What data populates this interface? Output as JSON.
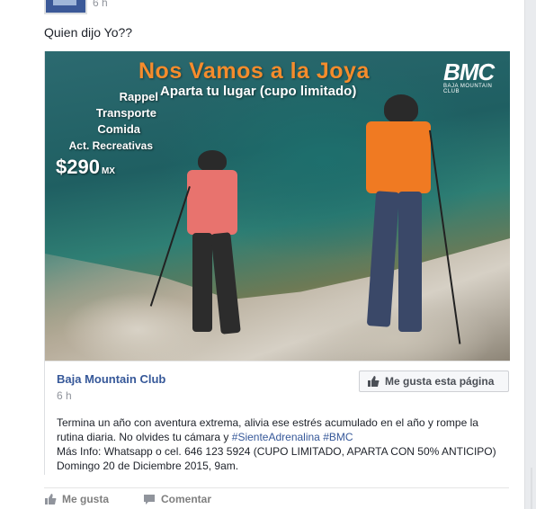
{
  "post": {
    "time_top": "6 h",
    "caption": "Quien dijo Yo??"
  },
  "photo": {
    "headline": "Nos Vamos a la Joya",
    "subhead": "Aparta tu lugar (cupo limitado)",
    "logo_mark": "BMC",
    "logo_sub": "BAJA MOUNTAIN CLUB",
    "services": [
      "Rappel",
      "Transporte",
      "Comida",
      "Act. Recreativas"
    ],
    "price": "$290",
    "currency": "MX"
  },
  "shared": {
    "page_name": "Baja Mountain Club",
    "time": "6 h",
    "like_page_label": "Me gusta esta página",
    "text_part1": "Termina un año con aventura extrema, alivia ese estrés acumulado en el año y rompe la rutina diaria. No olvides tu cámara y ",
    "hashtag1": "#SienteAdrenalina",
    "hashtag2": "#BMC",
    "text_part2": "Más Info: Whatsapp o cel. 646 123 5924 (CUPO LIMITADO, APARTA CON 50% ANTICIPO) Domingo 20 de Diciembre 2015, 9am."
  },
  "actions": {
    "like": "Me gusta",
    "comment": "Comentar"
  },
  "colors": {
    "link": "#365899",
    "headline": "#f58c2c",
    "muted": "#90949c"
  }
}
